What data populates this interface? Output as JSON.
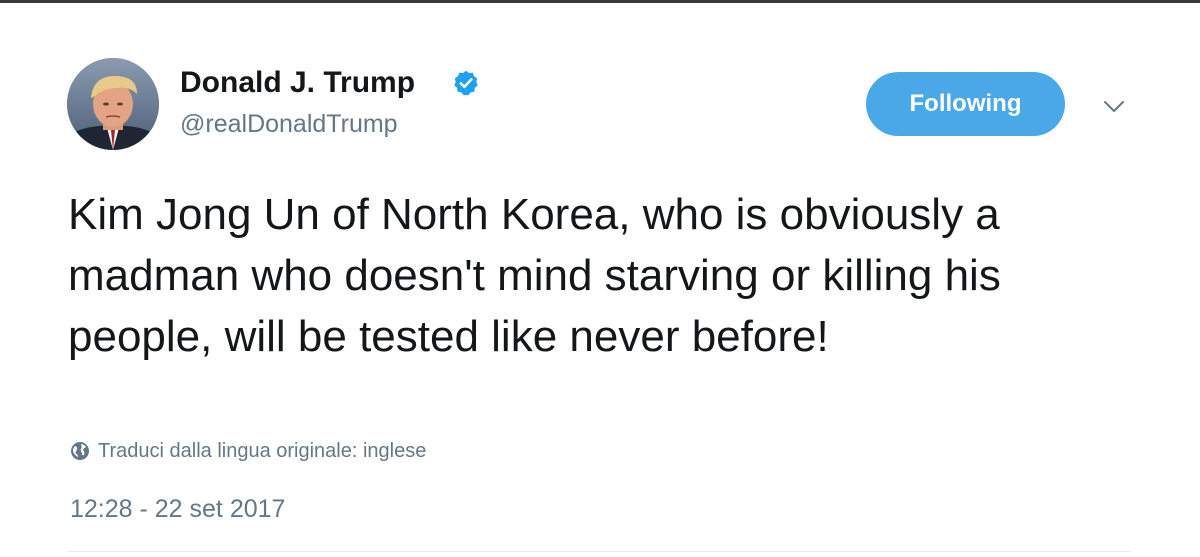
{
  "tweet": {
    "display_name": "Donald J. Trump",
    "handle": "@realDonaldTrump",
    "verified_icon": "verified-badge-icon",
    "follow_label": "Following",
    "menu_icon": "chevron-down-icon",
    "text": "Kim Jong Un of North Korea, who is obviously a madman who doesn't mind starving or killing his people, will be tested like never before!",
    "translate_icon": "globe-icon",
    "translate_label": "Traduci dalla lingua originale: inglese",
    "timestamp": "12:28 - 22 set 2017"
  },
  "colors": {
    "accent": "#4aa7e8",
    "text_primary": "#14171a",
    "text_secondary": "#657786",
    "verified": "#1da1f2"
  }
}
